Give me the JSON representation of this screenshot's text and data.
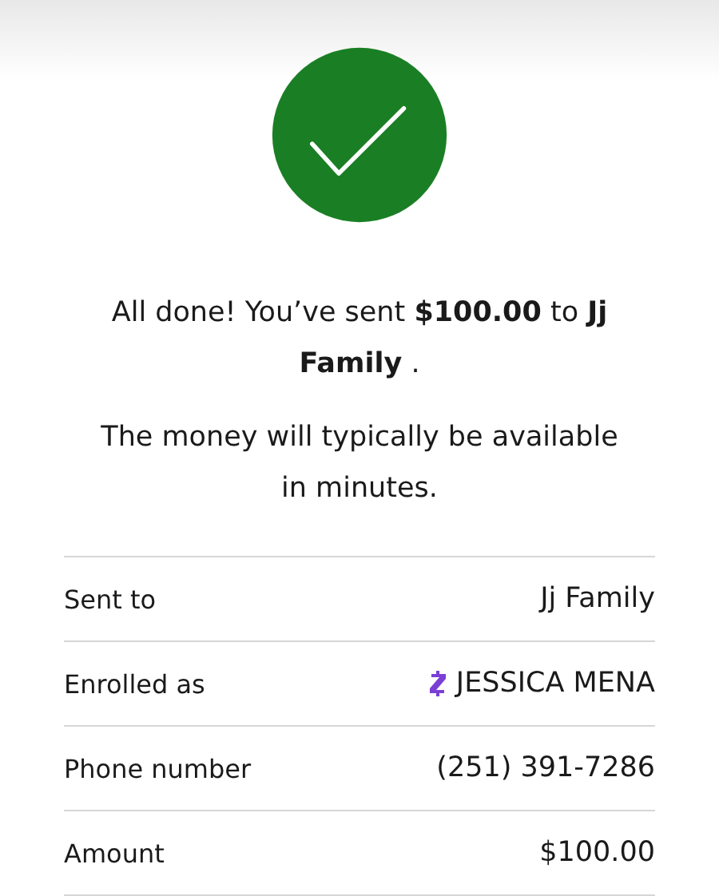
{
  "status": {
    "kind": "success"
  },
  "message": "All done! You’ve sent **$100.00** to **Jj Family** .",
  "note": "The money will typically be available in minutes.",
  "details": [
    {
      "kind": "text",
      "label": "Sent to",
      "value": "Jj Family"
    },
    {
      "kind": "enrolled",
      "label": "Enrolled as",
      "value": "JESSICA MENA"
    },
    {
      "kind": "text",
      "label": "Phone number",
      "value": "(251) 391-7286"
    },
    {
      "kind": "text",
      "label": "Amount",
      "value": "$100.00"
    }
  ]
}
